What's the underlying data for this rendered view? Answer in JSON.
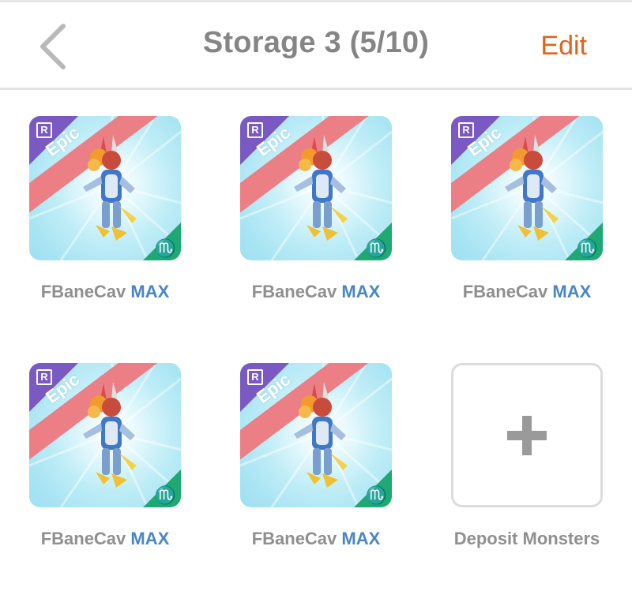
{
  "header": {
    "title": "Storage 3 (5/10)",
    "edit_label": "Edit",
    "back_icon": "chevron-left-icon"
  },
  "colors": {
    "accent": "#e36219",
    "title": "#858585",
    "max": "#4a86c5",
    "epic_band": "#ec7e86",
    "rank_corner": "#7b59c2",
    "element_corner": "#1fa872"
  },
  "monsters": [
    {
      "name": "FBaneCav",
      "level_tag": "MAX",
      "rarity": "Epic",
      "rank_badge": "R",
      "element_icon": "scorpio-icon"
    },
    {
      "name": "FBaneCav",
      "level_tag": "MAX",
      "rarity": "Epic",
      "rank_badge": "R",
      "element_icon": "scorpio-icon"
    },
    {
      "name": "FBaneCav",
      "level_tag": "MAX",
      "rarity": "Epic",
      "rank_badge": "R",
      "element_icon": "scorpio-icon"
    },
    {
      "name": "FBaneCav",
      "level_tag": "MAX",
      "rarity": "Epic",
      "rank_badge": "R",
      "element_icon": "scorpio-icon"
    },
    {
      "name": "FBaneCav",
      "level_tag": "MAX",
      "rarity": "Epic",
      "rank_badge": "R",
      "element_icon": "scorpio-icon"
    }
  ],
  "deposit": {
    "label": "Deposit Monsters",
    "icon": "plus-icon"
  }
}
